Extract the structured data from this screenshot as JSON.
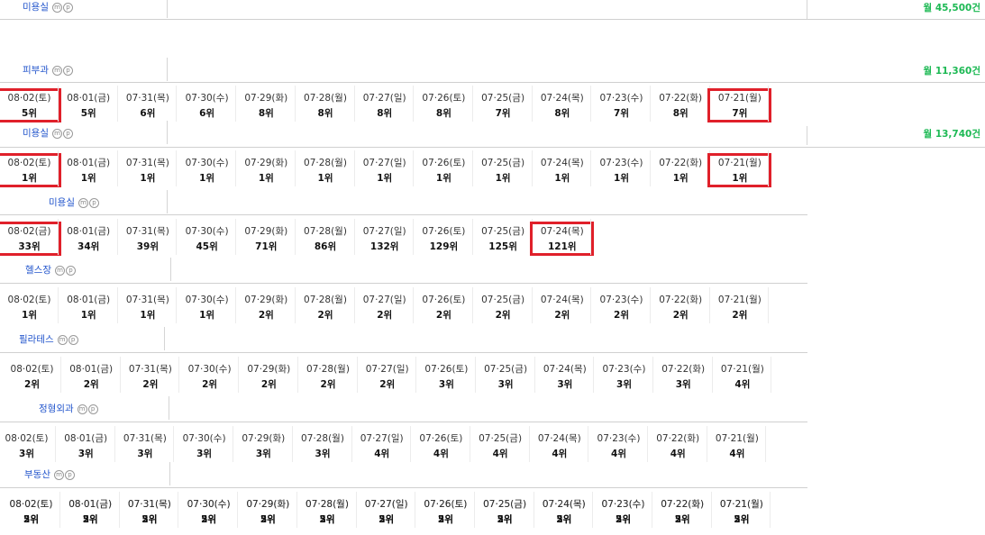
{
  "rows": [
    {
      "keyword": "미용실",
      "searches": "월 45,500건",
      "dates": [],
      "ranks": []
    },
    {
      "keyword": "피부과",
      "searches": "월 11,360건",
      "dates": [
        "08·02(토)",
        "08·01(금)",
        "07·31(목)",
        "07·30(수)",
        "07·29(화)",
        "07·28(월)",
        "07·27(일)",
        "07·26(토)",
        "07·25(금)",
        "07·24(목)",
        "07·23(수)",
        "07·22(화)",
        "07·21(월)"
      ],
      "ranks": [
        "5위",
        "5위",
        "6위",
        "6위",
        "8위",
        "8위",
        "8위",
        "8위",
        "7위",
        "8위",
        "7위",
        "8위",
        "7위"
      ],
      "highlight": [
        0,
        12
      ]
    },
    {
      "keyword": "미용실",
      "searches": "월 13,740건",
      "dates": [
        "08·02(토)",
        "08·01(금)",
        "07·31(목)",
        "07·30(수)",
        "07·29(화)",
        "07·28(월)",
        "07·27(일)",
        "07·26(토)",
        "07·25(금)",
        "07·24(목)",
        "07·23(수)",
        "07·22(화)",
        "07·21(월)"
      ],
      "ranks": [
        "1위",
        "1위",
        "1위",
        "1위",
        "1위",
        "1위",
        "1위",
        "1위",
        "1위",
        "1위",
        "1위",
        "1위",
        "1위"
      ],
      "highlight": [
        0,
        12
      ]
    },
    {
      "keyword": "미용실",
      "searches": "",
      "dates": [
        "08·02(금)",
        "08·01(금)",
        "07·31(목)",
        "07·30(수)",
        "07·29(화)",
        "07·28(월)",
        "07·27(일)",
        "07·26(토)",
        "07·25(금)",
        "07·24(목)"
      ],
      "ranks": [
        "33위",
        "34위",
        "39위",
        "45위",
        "71위",
        "86위",
        "132위",
        "129위",
        "125위",
        "121위"
      ],
      "highlight": [
        0,
        9
      ]
    },
    {
      "keyword": "헬스장",
      "searches": "",
      "dates": [
        "08·02(토)",
        "08·01(금)",
        "07·31(목)",
        "07·30(수)",
        "07·29(화)",
        "07·28(월)",
        "07·27(일)",
        "07·26(토)",
        "07·25(금)",
        "07·24(목)",
        "07·23(수)",
        "07·22(화)",
        "07·21(월)"
      ],
      "ranks": [
        "1위",
        "1위",
        "1위",
        "1위",
        "2위",
        "2위",
        "2위",
        "2위",
        "2위",
        "2위",
        "2위",
        "2위",
        "2위"
      ],
      "highlight": []
    },
    {
      "keyword": "필라테스",
      "searches": "",
      "dates": [
        "08·02(토)",
        "08·01(금)",
        "07·31(목)",
        "07·30(수)",
        "07·29(화)",
        "07·28(월)",
        "07·27(일)",
        "07·26(토)",
        "07·25(금)",
        "07·24(목)",
        "07·23(수)",
        "07·22(화)",
        "07·21(월)"
      ],
      "ranks": [
        "2위",
        "2위",
        "2위",
        "2위",
        "2위",
        "2위",
        "2위",
        "3위",
        "3위",
        "3위",
        "3위",
        "3위",
        "4위"
      ],
      "highlight": []
    },
    {
      "keyword": "정형외과",
      "searches": "",
      "dates": [
        "08·02(토)",
        "08·01(금)",
        "07·31(목)",
        "07·30(수)",
        "07·29(화)",
        "07·28(월)",
        "07·27(일)",
        "07·26(토)",
        "07·25(금)",
        "07·24(목)",
        "07·23(수)",
        "07·22(화)",
        "07·21(월)"
      ],
      "ranks": [
        "3위",
        "3위",
        "3위",
        "3위",
        "3위",
        "3위",
        "4위",
        "4위",
        "4위",
        "4위",
        "4위",
        "4위",
        "4위"
      ],
      "highlight": []
    },
    {
      "keyword": "부동산",
      "searches": "",
      "dates": [
        "08·02(토)",
        "08·01(금)",
        "07·31(목)",
        "07·30(수)",
        "07·29(화)",
        "07·28(월)",
        "07·27(일)",
        "07·26(토)",
        "07·25(금)",
        "07·24(목)",
        "07·23(수)",
        "07·22(화)",
        "07·21(월)"
      ],
      "ranks": [
        "2위",
        "2위",
        "2위",
        "2위",
        "2위",
        "2위",
        "2위",
        "2위",
        "2위",
        "2위",
        "2위",
        "2위",
        "2위"
      ],
      "highlight": []
    },
    {
      "keyword": "",
      "searches": "",
      "dates": [
        "08·02(토)",
        "08·01(금)",
        "07·31(목)",
        "07·30(수)",
        "07·29(화)",
        "07·28(월)",
        "07·27(일)",
        "07·26(토)",
        "07·25(금)",
        "07·24(목)",
        "07·23(수)",
        "07·22(화)",
        "07·21(월)"
      ],
      "ranks": [
        "5위",
        "5위",
        "5위",
        "5위",
        "5위",
        "5위",
        "5위",
        "5위",
        "5위",
        "5위",
        "5위",
        "5위",
        "5위"
      ],
      "highlight": []
    }
  ],
  "mp": {
    "m": "m",
    "p": "p"
  },
  "colors": {
    "keyword": "#2255cc",
    "searches": "#1db954",
    "highlight": "#e0202a"
  }
}
